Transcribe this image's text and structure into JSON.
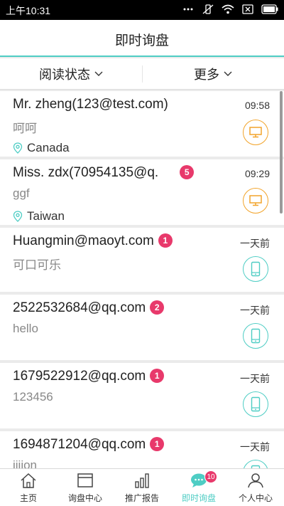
{
  "status_bar": {
    "time": "上午10:31"
  },
  "header": {
    "title": "即时询盘"
  },
  "filters": {
    "read_status": "阅读状态",
    "more": "更多"
  },
  "conversations": [
    {
      "name": "Mr. zheng(123@test.com)",
      "badge": "",
      "message": "呵呵",
      "location": "Canada",
      "time": "09:58",
      "device": "pc"
    },
    {
      "name": "Miss. zdx(70954135@q.",
      "badge": "5",
      "message": "ggf",
      "location": "Taiwan",
      "time": "09:29",
      "device": "pc"
    },
    {
      "name": "Huangmin@maoyt.com",
      "badge": "1",
      "message": "可口可乐",
      "location": "",
      "time": "一天前",
      "device": "phone"
    },
    {
      "name": "2522532684@qq.com",
      "badge": "2",
      "message": "hello",
      "location": "",
      "time": "一天前",
      "device": "phone"
    },
    {
      "name": "1679522912@qq.com",
      "badge": "1",
      "message": "123456",
      "location": "",
      "time": "一天前",
      "device": "phone"
    },
    {
      "name": "1694871204@qq.com",
      "badge": "1",
      "message": "iiiion",
      "location": "",
      "time": "一天前",
      "device": "phone"
    }
  ],
  "tabs": [
    {
      "label": "主页",
      "icon": "home-icon"
    },
    {
      "label": "询盘中心",
      "icon": "inbox-icon"
    },
    {
      "label": "推广报告",
      "icon": "bar-chart-icon"
    },
    {
      "label": "即时询盘",
      "icon": "chat-bubble-icon",
      "badge": "10",
      "active": true
    },
    {
      "label": "个人中心",
      "icon": "user-icon"
    }
  ],
  "colors": {
    "accent": "#4ecdc4",
    "badge": "#e8396b",
    "pc_device": "#f2a42b",
    "phone_device": "#4ecdc4"
  }
}
